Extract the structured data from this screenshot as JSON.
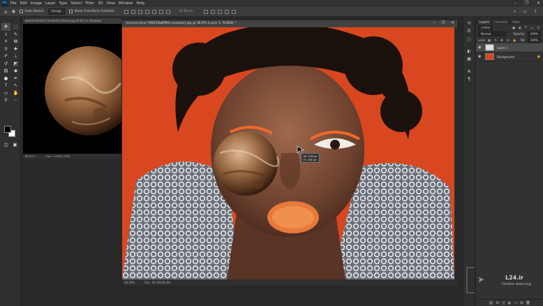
{
  "menu": [
    "File",
    "Edit",
    "Image",
    "Layer",
    "Type",
    "Select",
    "Filter",
    "3D",
    "View",
    "Window",
    "Help"
  ],
  "app_logo": "Ps",
  "options_bar": {
    "auto_select_label": "Auto-Select:",
    "auto_select_value": "Group",
    "transform_label": "Show Transform Controls",
    "mode_3d": "3D Mode:"
  },
  "doc1": {
    "tab_title": "6890AC3E9EFFC780650F2FE9404.jpg @ 66.7% (RGB/8#)",
    "zoom": "66.67%",
    "doc_size": "Doc: 1.65M/1.65M"
  },
  "doc2": {
    "tab_title": "monica-silva-rTsN4ZNqD9KU-unsplash.jpg @ 38.6% (Layer 1, RGB/8) *",
    "zoom": "38.59%",
    "doc_size": "Doc: 40.1M/36.0M",
    "tooltip_w": "W:  178 px",
    "tooltip_h": "H:  134 px"
  },
  "layers_panel": {
    "tabs": [
      "Layers",
      "Channels",
      "Paths"
    ],
    "kind_label": "Kind",
    "blend_mode": "Normal",
    "opacity_label": "Opacity:",
    "opacity_value": "100%",
    "lock_label": "Lock:",
    "fill_label": "Fill:",
    "fill_value": "100%",
    "layers": [
      {
        "name": "Layer 1"
      },
      {
        "name": "Background"
      }
    ]
  },
  "watermark": {
    "brand": "L24.ir",
    "sub": "Online learning"
  },
  "colors": {
    "canvas_orange": "#d8471f",
    "planet_brown": "#8b5a35"
  }
}
